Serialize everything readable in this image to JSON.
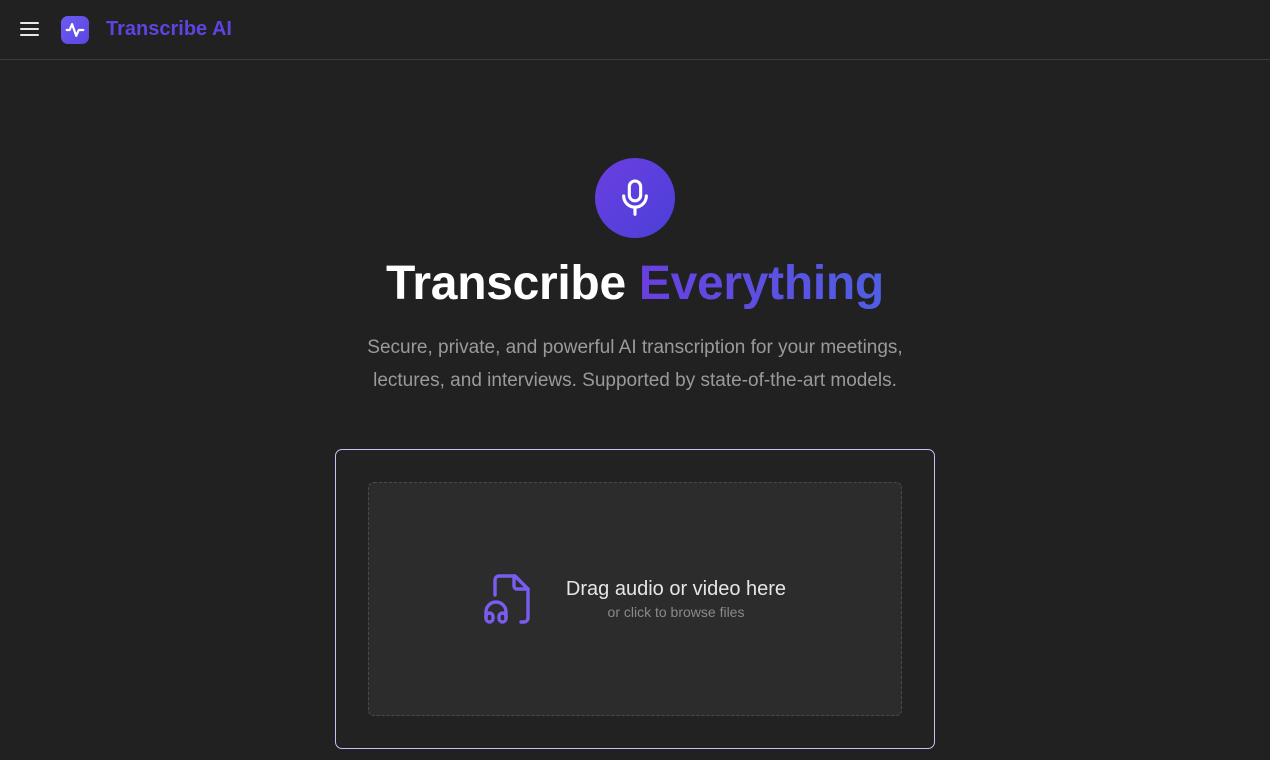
{
  "header": {
    "menu_icon": "hamburger-menu-icon",
    "logo_icon": "waveform-pulse-icon",
    "brand": "Transcribe AI"
  },
  "hero": {
    "icon": "microphone-icon",
    "title_part1": "Transcribe ",
    "title_part2": "Everything",
    "subtitle": "Secure, private, and powerful AI transcription for your meetings, lectures, and interviews. Supported by state-of-the-art models."
  },
  "upload": {
    "icon": "audio-file-icon",
    "title": "Drag audio or video here",
    "subtitle": "or click to browse files"
  },
  "colors": {
    "background": "#212121",
    "accent": "#5b45e0",
    "card_border": "#c8bff5",
    "dropzone_bg": "#2c2c2c"
  }
}
